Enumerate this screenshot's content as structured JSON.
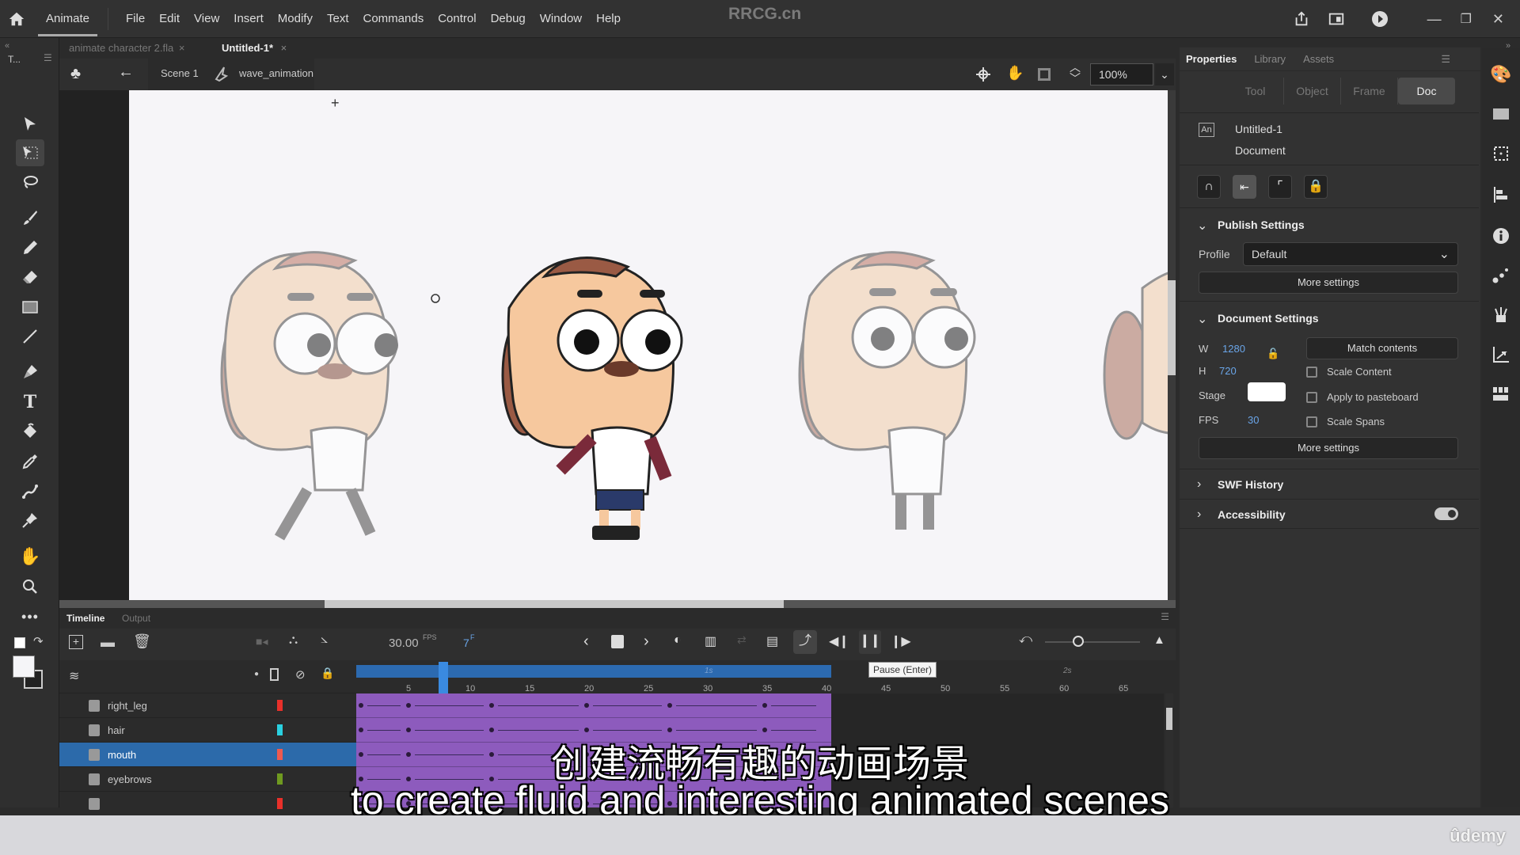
{
  "menubar": {
    "app_name": "Animate",
    "menus": [
      "File",
      "Edit",
      "View",
      "Insert",
      "Modify",
      "Text",
      "Commands",
      "Control",
      "Debug",
      "Window",
      "Help"
    ],
    "watermark": "RRCG.cn"
  },
  "doc_tabs": [
    {
      "label": "animate character 2.fla",
      "active": false
    },
    {
      "label": "Untitled-1*",
      "active": true
    }
  ],
  "editbar": {
    "scene": "Scene 1",
    "symbol": "wave_animation",
    "zoom": "100%"
  },
  "toolbar": {
    "header": "T...",
    "tools": [
      "selection",
      "subselection",
      "lasso",
      "brush",
      "pencil",
      "eraser",
      "rectangle",
      "line",
      "pen",
      "text",
      "paint-bucket",
      "eyedropper",
      "bone",
      "pin",
      "hand",
      "zoom",
      "more"
    ]
  },
  "properties": {
    "tabs": [
      "Properties",
      "Library",
      "Assets"
    ],
    "active_tab": "Properties",
    "subtabs": [
      "Tool",
      "Object",
      "Frame",
      "Doc"
    ],
    "active_subtab": "Doc",
    "doc_name": "Untitled-1",
    "doc_type": "Document",
    "doc_badge": "An",
    "publish": {
      "title": "Publish Settings",
      "profile_label": "Profile",
      "profile_value": "Default",
      "more_settings": "More settings"
    },
    "document": {
      "title": "Document Settings",
      "w_label": "W",
      "w_value": "1280",
      "h_label": "H",
      "h_value": "720",
      "stage_label": "Stage",
      "stage_color": "#ffffff",
      "fps_label": "FPS",
      "fps_value": "30",
      "match_contents": "Match contents",
      "scale_content": "Scale Content",
      "apply_pasteboard": "Apply to pasteboard",
      "scale_spans": "Scale Spans",
      "more_settings": "More settings"
    },
    "swf_history": "SWF History",
    "accessibility": "Accessibility"
  },
  "timeline": {
    "tabs": [
      "Timeline",
      "Output"
    ],
    "active_tab": "Timeline",
    "fps_value": "30.00",
    "fps_unit": "FPS",
    "current_frame": "7",
    "frame_unit": "F",
    "tooltip": "Pause (Enter)",
    "ruler_ticks": [
      "5",
      "10",
      "15",
      "20",
      "25",
      "30",
      "35",
      "40",
      "45",
      "50",
      "55",
      "60",
      "65"
    ],
    "second_marks": [
      "1s",
      "2s"
    ],
    "current_frame_num": 7,
    "span_end_frame": 40,
    "layers": [
      {
        "name": "right_leg",
        "color": "#e8302a",
        "selected": false
      },
      {
        "name": "hair",
        "color": "#2ad0e0",
        "selected": false
      },
      {
        "name": "mouth",
        "color": "#ee5a50",
        "selected": true
      },
      {
        "name": "eyebrows",
        "color": "#6f9a20",
        "selected": false
      },
      {
        "name": "",
        "color": "#e8302a",
        "selected": false
      }
    ]
  },
  "subtitles": {
    "cn": "创建流畅有趣的动画场景",
    "en": "to create fluid and interesting animated scenes"
  },
  "branding": "ûdemy"
}
